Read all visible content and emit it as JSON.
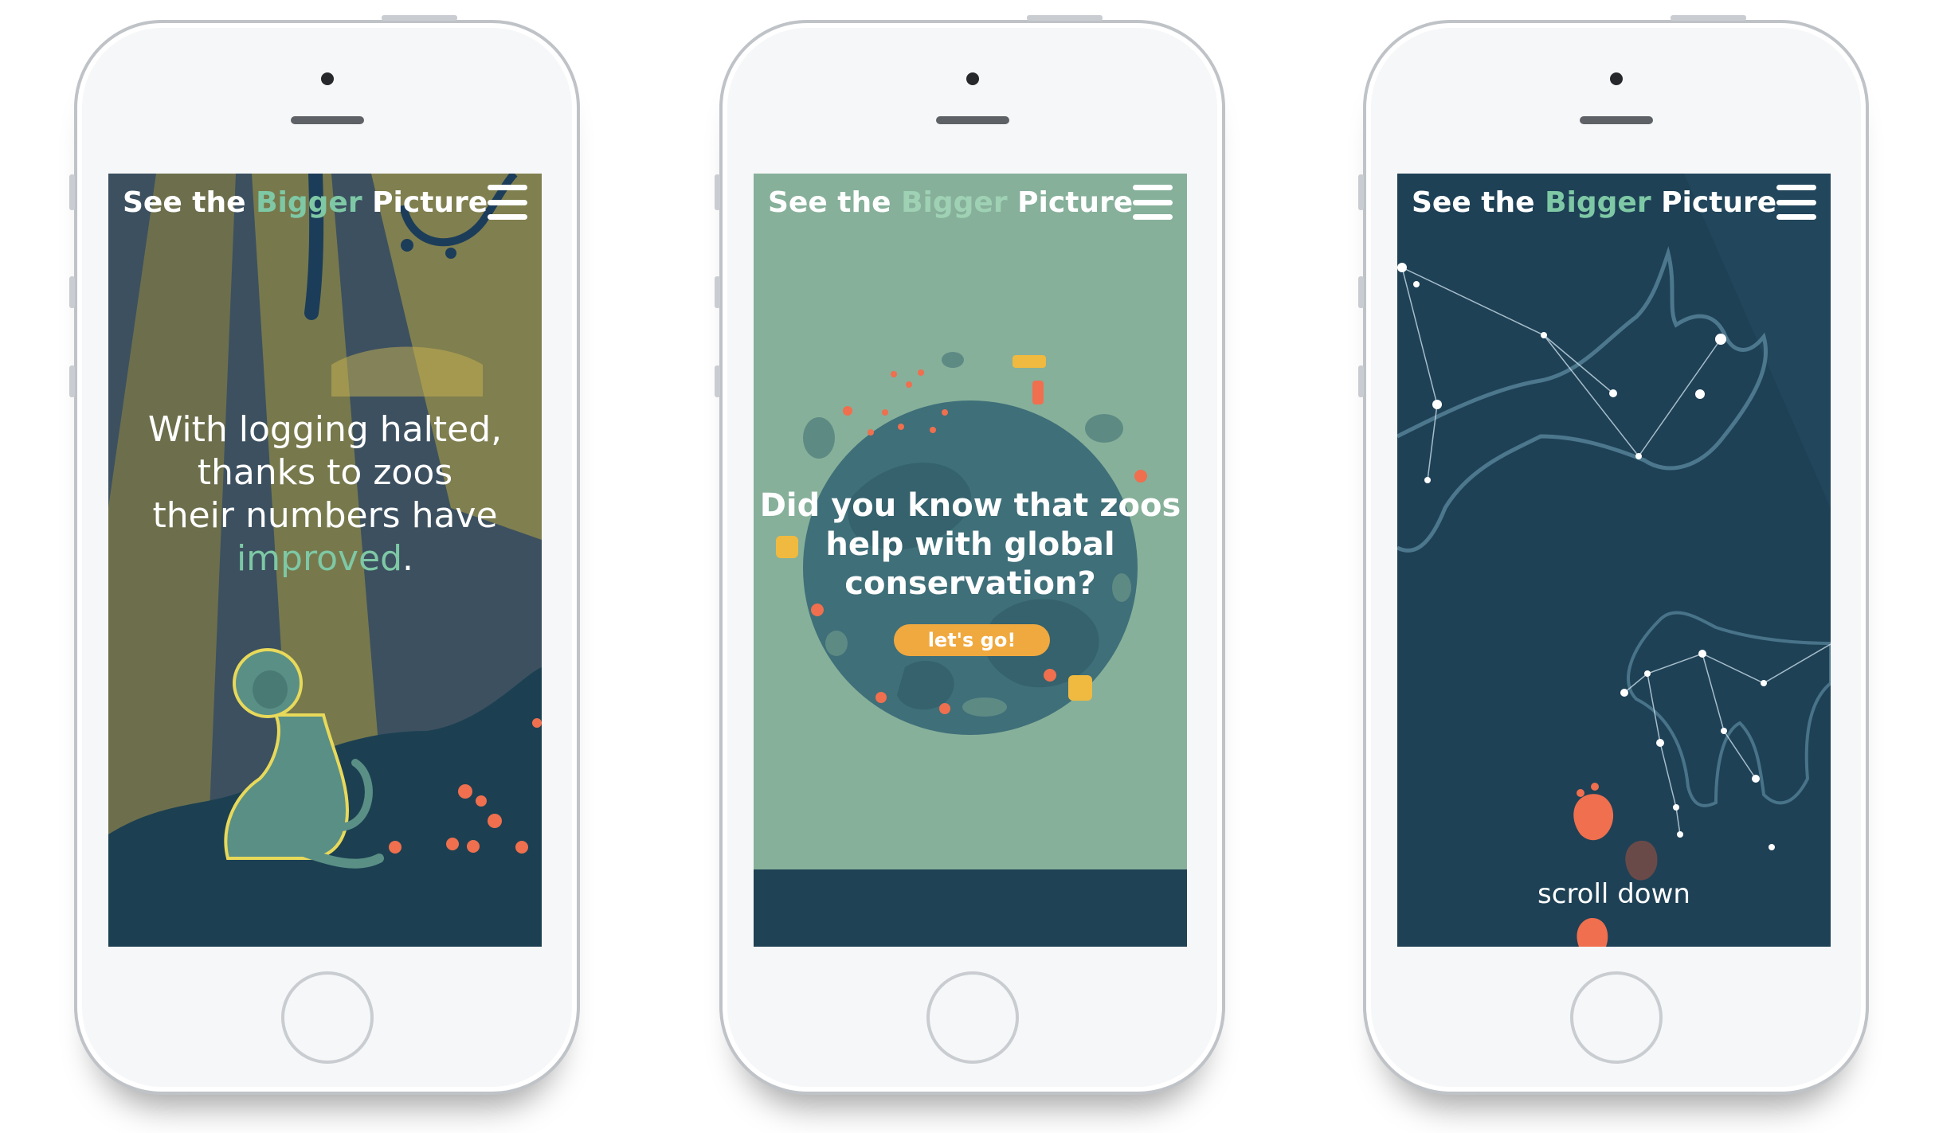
{
  "brand": {
    "prefix": "See the ",
    "accent": "Bigger",
    "suffix": " Picture"
  },
  "icons": {
    "menu": "hamburger-menu-icon"
  },
  "colors": {
    "accent_green": "#7ec8a5",
    "screen1_bg": "#3c5060",
    "screen2_bg": "#86b09a",
    "screen3_bg": "#1e4156",
    "button_orange": "#f0a93f",
    "coral": "#ef6f4e"
  },
  "screens": [
    {
      "message": {
        "line1": "With logging halted,",
        "line2": "thanks to zoos",
        "line3": "their numbers have",
        "highlight": "improved",
        "end": "."
      }
    },
    {
      "question": {
        "line1": "Did you know that zoos",
        "line2": "help with global",
        "line3": "conservation?"
      },
      "cta_label": "let's go!"
    },
    {
      "scroll_label": "scroll down"
    }
  ]
}
